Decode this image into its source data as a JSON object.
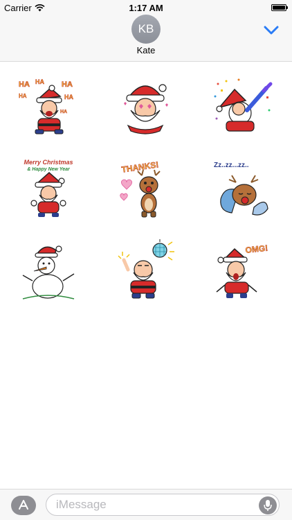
{
  "status_bar": {
    "carrier": "Carrier",
    "time": "1:17 AM",
    "battery_level": 1.0
  },
  "header": {
    "avatar_initials": "KB",
    "contact_name": "Kate"
  },
  "stickers": [
    {
      "name": "sticker-santa-laughing",
      "text": "HA HA HA HA HA HA"
    },
    {
      "name": "sticker-santa-love",
      "text": ""
    },
    {
      "name": "sticker-santa-party",
      "text": ""
    },
    {
      "name": "sticker-santa-merry-christmas",
      "text": "Merry Christmas & Happy New Year"
    },
    {
      "name": "sticker-reindeer-thanks",
      "text": "THANKS!"
    },
    {
      "name": "sticker-reindeer-sleeping",
      "text": "Zz..zz...zz.."
    },
    {
      "name": "sticker-snowman",
      "text": ""
    },
    {
      "name": "sticker-santa-disco",
      "text": ""
    },
    {
      "name": "sticker-santa-omg",
      "text": "OMG!"
    }
  ],
  "compose": {
    "placeholder": "iMessage"
  },
  "colors": {
    "accent": "#2a7cf6",
    "santa_red": "#d62b2b",
    "avatar_gray": "#999da5"
  },
  "icons": [
    "wifi-icon",
    "battery-icon",
    "chevron-down-icon",
    "app-store-icon",
    "microphone-icon"
  ]
}
